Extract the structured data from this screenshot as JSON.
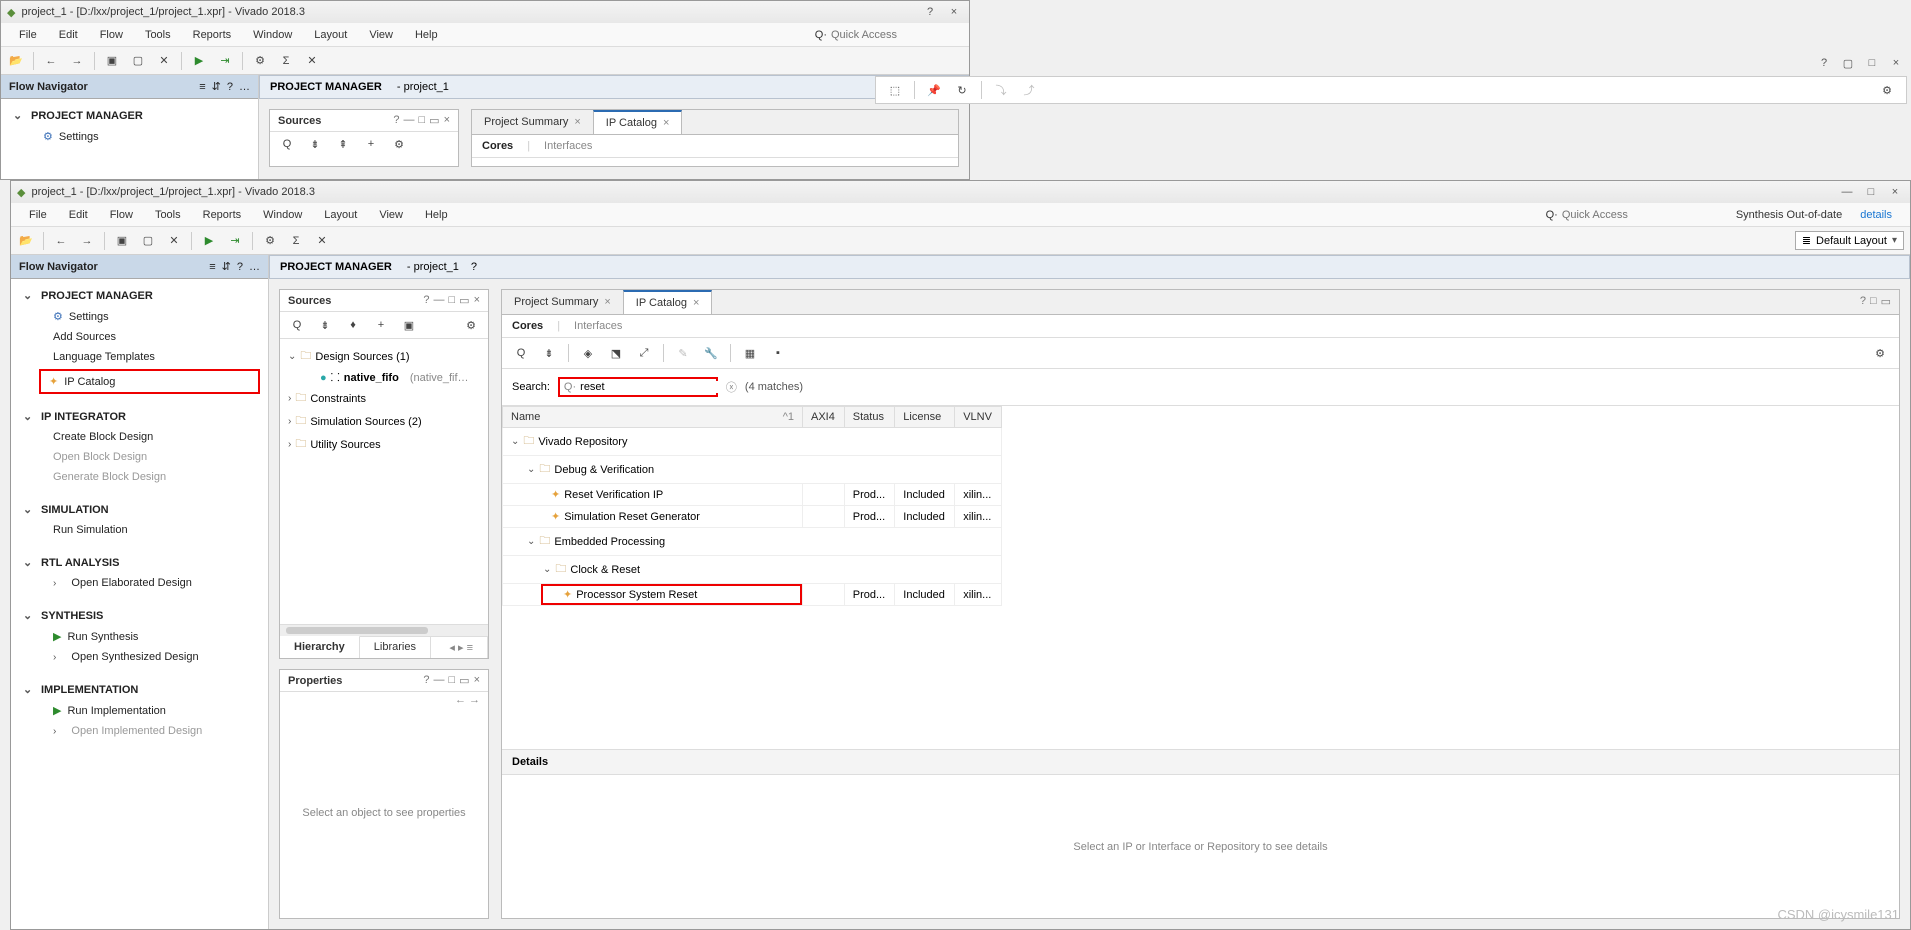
{
  "win1": {
    "title": "project_1 - [D:/lxx/project_1/project_1.xpr] - Vivado 2018.3",
    "menus": [
      "File",
      "Edit",
      "Flow",
      "Tools",
      "Reports",
      "Window",
      "Layout",
      "View",
      "Help"
    ],
    "quick_placeholder": "Quick Access",
    "flow_nav_title": "Flow Navigator",
    "pm_title": "PROJECT MANAGER",
    "pm_sub": "- project_1",
    "settings": "Settings",
    "sources": "Sources",
    "tabs": {
      "summary": "Project Summary",
      "ipcat": "IP Catalog"
    },
    "cores": "Cores",
    "interfaces": "Interfaces"
  },
  "win2": {
    "title": "project_1 - [D:/lxx/project_1/project_1.xpr] - Vivado 2018.3",
    "menus": [
      "File",
      "Edit",
      "Flow",
      "Tools",
      "Reports",
      "Window",
      "Layout",
      "View",
      "Help"
    ],
    "quick_placeholder": "Quick Access",
    "synth_status": "Synthesis Out-of-date",
    "details_link": "details",
    "layout": "Default Layout",
    "flow_nav_title": "Flow Navigator",
    "nav": {
      "pm": "PROJECT MANAGER",
      "settings": "Settings",
      "add_sources": "Add Sources",
      "lang_tpl": "Language Templates",
      "ip_catalog": "IP Catalog",
      "ip_int": "IP INTEGRATOR",
      "create_bd": "Create Block Design",
      "open_bd": "Open Block Design",
      "gen_bd": "Generate Block Design",
      "sim": "SIMULATION",
      "run_sim": "Run Simulation",
      "rtl": "RTL ANALYSIS",
      "open_elab": "Open Elaborated Design",
      "synth": "SYNTHESIS",
      "run_synth": "Run Synthesis",
      "open_synth": "Open Synthesized Design",
      "impl": "IMPLEMENTATION",
      "run_impl": "Run Implementation",
      "open_impl": "Open Implemented Design"
    },
    "pm_title": "PROJECT MANAGER",
    "pm_sub": "- project_1",
    "sources": {
      "title": "Sources",
      "design_sources": "Design Sources (1)",
      "native_fifo": "native_fifo",
      "native_fifo_suffix": "(native_fif…",
      "constraints": "Constraints",
      "sim_sources": "Simulation Sources (2)",
      "util_sources": "Utility Sources",
      "tab_hierarchy": "Hierarchy",
      "tab_libraries": "Libraries"
    },
    "props": {
      "title": "Properties",
      "placeholder": "Select an object to see properties"
    },
    "ip": {
      "tab_summary": "Project Summary",
      "tab_catalog": "IP Catalog",
      "cores": "Cores",
      "interfaces": "Interfaces",
      "search_label": "Search:",
      "search_value": "reset",
      "match_count": "(4 matches)",
      "cols": {
        "name": "Name",
        "axi4": "AXI4",
        "status": "Status",
        "license": "License",
        "vlnv": "VLNV"
      },
      "tree": {
        "repo": "Vivado Repository",
        "debug": "Debug & Verification",
        "rvip": "Reset Verification IP",
        "srg": "Simulation Reset Generator",
        "embed": "Embedded Processing",
        "clk": "Clock & Reset",
        "psr": "Processor System Reset"
      },
      "vals": {
        "prod": "Prod...",
        "included": "Included",
        "xilin": "xilin..."
      },
      "details_hdr": "Details",
      "details_body": "Select an IP or Interface or Repository to see details"
    }
  },
  "watermark": "CSDN @icysmile131"
}
